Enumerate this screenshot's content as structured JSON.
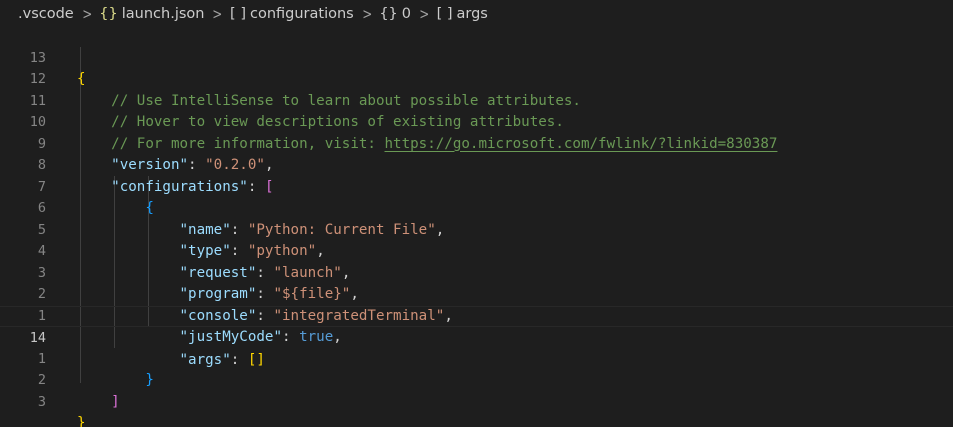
{
  "breadcrumb": {
    "items": [
      {
        "label": ".vscode",
        "icon": ""
      },
      {
        "label": "launch.json",
        "icon": "{}"
      },
      {
        "label": "configurations",
        "icon": "[ ]"
      },
      {
        "label": "0",
        "icon": "{}"
      },
      {
        "label": "args",
        "icon": "[ ]"
      }
    ],
    "separator": ">"
  },
  "editor": {
    "line_numbers": [
      "13",
      "12",
      "11",
      "10",
      "9",
      "8",
      "7",
      "6",
      "5",
      "4",
      "3",
      "2",
      "1",
      "14",
      "1",
      "2",
      "3"
    ],
    "current_line_number": "14",
    "comments": [
      "// Use IntelliSense to learn about possible attributes.",
      "// Hover to view descriptions of existing attributes.",
      "// For more information, visit: "
    ],
    "link": "https://go.microsoft.com/fwlink/?linkid=830387",
    "open_brace": "{",
    "close_brace": "}",
    "version_key": "\"version\"",
    "version_value": "\"0.2.0\"",
    "configurations_key": "\"configurations\"",
    "open_bracket": "[",
    "close_bracket": "]",
    "config": {
      "name_key": "\"name\"",
      "name_value": "\"Python: Current File\"",
      "type_key": "\"type\"",
      "type_value": "\"python\"",
      "request_key": "\"request\"",
      "request_value": "\"launch\"",
      "program_key": "\"program\"",
      "program_value": "\"${file}\"",
      "console_key": "\"console\"",
      "console_value": "\"integratedTerminal\"",
      "justmycode_key": "\"justMyCode\"",
      "justmycode_value": "true",
      "args_key": "\"args\"",
      "args_value": "[]"
    },
    "colors": {
      "background": "#1e1e1e",
      "key": "#9cdcfe",
      "string": "#ce9178",
      "comment": "#6a9955",
      "keyword": "#569cd6",
      "brace_level1": "#ffd700",
      "brace_level2": "#da70d6",
      "brace_level3": "#179fff"
    }
  }
}
